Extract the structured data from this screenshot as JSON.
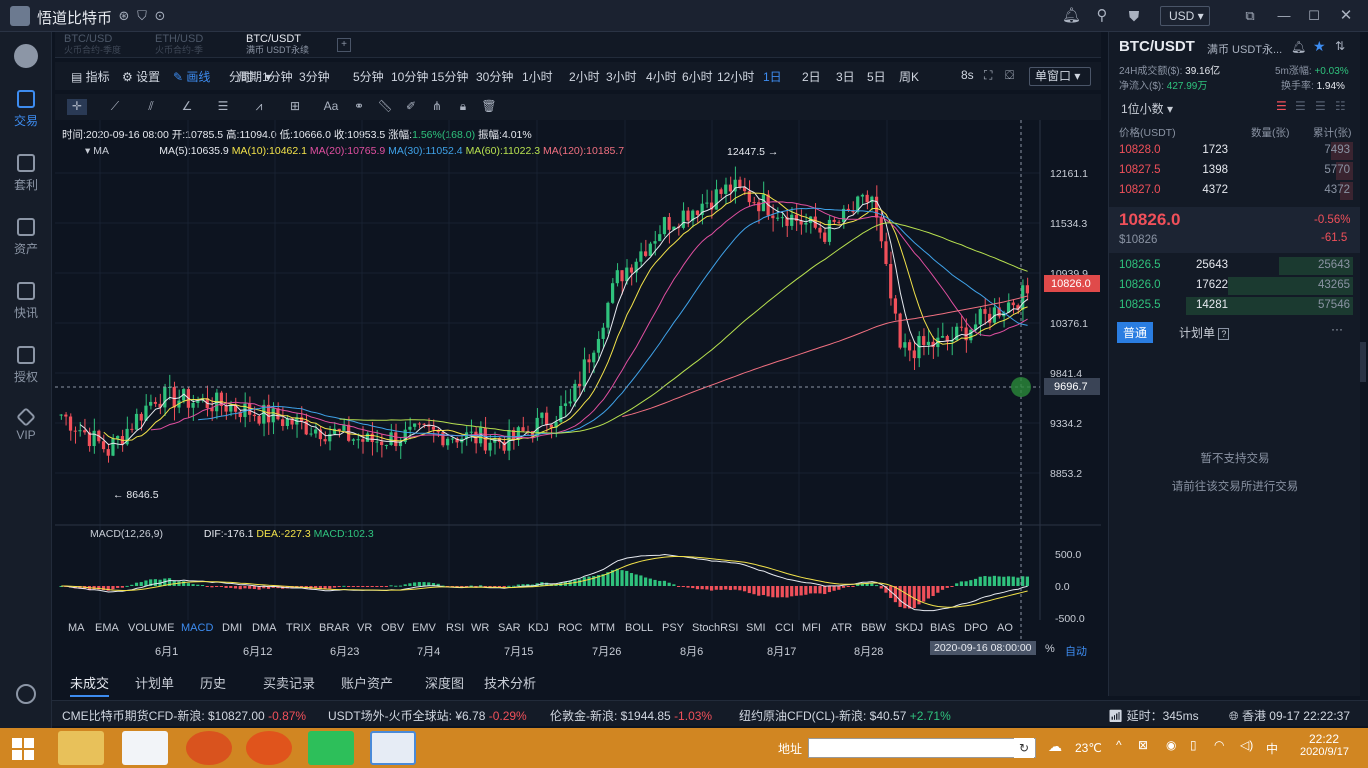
{
  "app": {
    "title": "悟道比特币",
    "currency": "USD"
  },
  "sidebar": [
    {
      "label": "交易",
      "active": true
    },
    {
      "label": "套利"
    },
    {
      "label": "资产"
    },
    {
      "label": "快讯"
    },
    {
      "label": "授权"
    },
    {
      "label": "VIP"
    }
  ],
  "tabs": [
    {
      "name": "BTC/USD",
      "sub": "火币合约-季度"
    },
    {
      "name": "ETH/USD",
      "sub": "火币合约-季"
    },
    {
      "name": "BTC/USDT",
      "sub": "满币 USDT永续",
      "active": true
    }
  ],
  "toolbar": {
    "indicators": "指标",
    "settings": "设置",
    "draw": "画线",
    "period": "周期",
    "timeframes": [
      "分时",
      "1分钟",
      "3分钟",
      "5分钟",
      "10分钟",
      "15分钟",
      "30分钟",
      "1小时",
      "2小时",
      "3小时",
      "4小时",
      "6小时",
      "12小时",
      "1日",
      "2日",
      "3日",
      "5日",
      "周K"
    ],
    "active_timeframe": "1日",
    "refresh": "8s",
    "window": "单窗口"
  },
  "ohlc": {
    "time": "时间:2020-09-16 08:00",
    "open": "开:10785.5",
    "high": "高:11094.0",
    "low": "低:10666.0",
    "close": "收:10953.5",
    "change_label": "涨幅:",
    "change": "1.56%(168.0)",
    "amp": "振幅:4.01%"
  },
  "ma": {
    "label": "MA",
    "ma5": "MA(5):10635.9",
    "ma10": "MA(10):10462.1",
    "ma20": "MA(20):10765.9",
    "ma30": "MA(30):11052.4",
    "ma60": "MA(60):11022.3",
    "ma120": "MA(120):10185.7"
  },
  "price_axis": [
    "12161.1",
    "11534.3",
    "10939.9",
    "10376.1",
    "9841.4",
    "9334.2",
    "8853.2"
  ],
  "current_price_tag": "10826.0",
  "crosshair_price": "9696.7",
  "annotations": {
    "high": "12447.5 →",
    "low": "← 8646.5"
  },
  "macd": {
    "label": "MACD(12,26,9)",
    "dif": "DIF:-176.1",
    "dea": "DEA:-227.3",
    "macd": "MACD:102.3",
    "axis": [
      "500.0",
      "0.0",
      "-500.0"
    ]
  },
  "indicator_list": [
    "MA",
    "EMA",
    "VOLUME",
    "MACD",
    "DMI",
    "DMA",
    "TRIX",
    "BRAR",
    "VR",
    "OBV",
    "EMV",
    "RSI",
    "WR",
    "SAR",
    "KDJ",
    "ROC",
    "MTM",
    "BOLL",
    "PSY",
    "StochRSI",
    "SMI",
    "CCI",
    "MFI",
    "ATR",
    "BBW",
    "SKDJ",
    "BIAS",
    "DPO",
    "AO"
  ],
  "active_indicator": "MACD",
  "date_axis": [
    "6月1",
    "6月12",
    "6月23",
    "7月4",
    "7月15",
    "7月26",
    "8月6",
    "8月17",
    "8月28"
  ],
  "crosshair_date": "2020-09-16 08:00:00",
  "auto": "自动",
  "pct": "%",
  "right": {
    "pair": "BTC/USDT",
    "pair_sub": "满币 USDT永...",
    "vol_label": "24H成交额($):",
    "vol": "39.16亿",
    "flow_label": "净流入($):",
    "flow": "427.99万",
    "chg5m_label": "5m涨幅:",
    "chg5m": "+0.03%",
    "turnover_label": "换手率:",
    "turnover": "1.94%",
    "decimals": "1位小数",
    "col_price": "价格(USDT)",
    "col_qty": "数量(张)",
    "col_total": "累计(张)",
    "asks": [
      [
        "10828.0",
        "1723",
        "7493"
      ],
      [
        "10827.5",
        "1398",
        "5770"
      ],
      [
        "10827.0",
        "4372",
        "4372"
      ]
    ],
    "last": "10826.0",
    "last_usd": "$10826",
    "last_pct": "-0.56%",
    "last_chg": "-61.5",
    "bids": [
      [
        "10826.5",
        "25643",
        "25643"
      ],
      [
        "10826.0",
        "17622",
        "43265"
      ],
      [
        "10825.5",
        "14281",
        "57546"
      ]
    ],
    "trade_tab1": "普通",
    "trade_tab2": "计划单",
    "no_trade": "暂不支持交易",
    "hint": "请前往该交易所进行交易"
  },
  "bottom_tabs": [
    "未成交",
    "计划单",
    "历史",
    "买卖记录",
    "账户资产",
    "深度图",
    "技术分析"
  ],
  "ticker": [
    {
      "name": "CME比特币期货CFD-新浪:",
      "price": "$10827.00",
      "chg": "-0.87%",
      "up": false
    },
    {
      "name": "USDT场外-火币全球站:",
      "price": "¥6.78",
      "chg": "-0.29%",
      "up": false
    },
    {
      "name": "伦敦金-新浪:",
      "price": "$1944.85",
      "chg": "-1.03%",
      "up": false
    },
    {
      "name": "纽约原油CFD(CL)-新浪:",
      "price": "$40.57",
      "chg": "+2.71%",
      "up": true
    }
  ],
  "status": {
    "latency": "延时：345ms",
    "region_time": "香港 09-17 22:22:37"
  },
  "taskbar": {
    "addr": "地址",
    "temp": "23℃",
    "ime": "中",
    "time": "22:22",
    "date": "2020/9/17"
  },
  "colors": {
    "up": "#2fc27d",
    "down": "#f0505a",
    "accent": "#3d8cf0"
  }
}
